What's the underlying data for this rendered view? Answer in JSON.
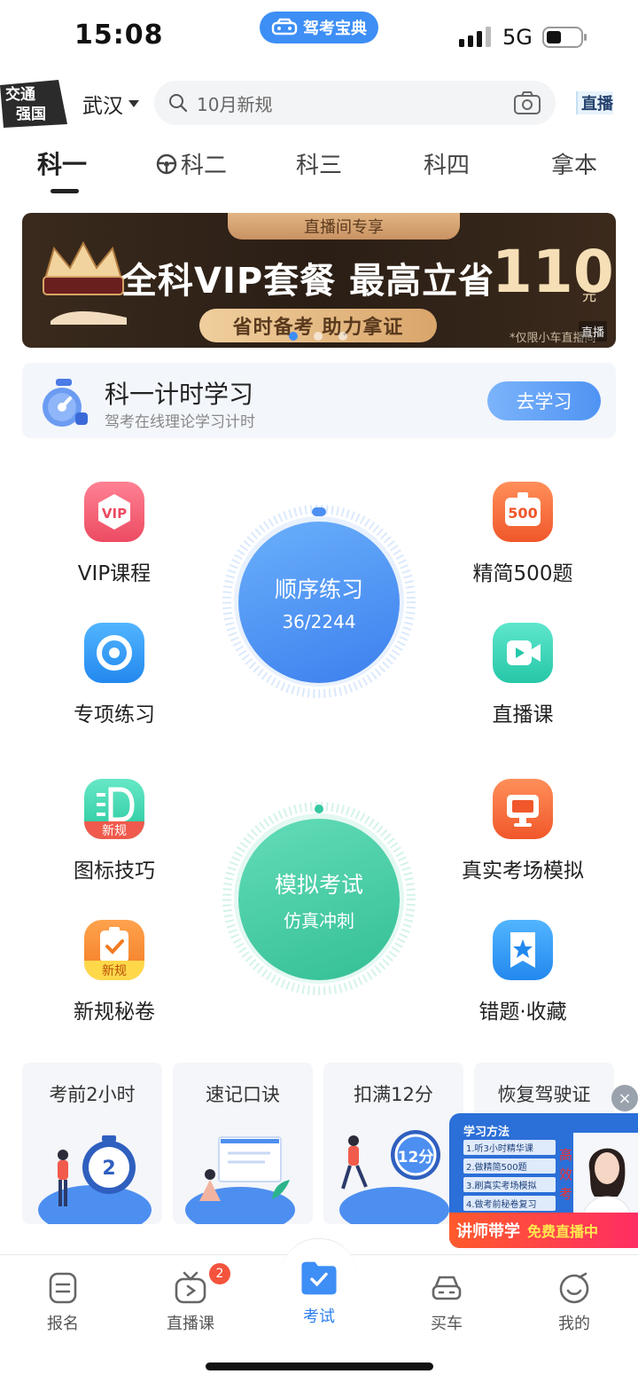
{
  "status_bar": {
    "time": "15:08",
    "network": "5G"
  },
  "app_pill": {
    "label": "驾考宝典"
  },
  "header": {
    "badge_text": "交通强国",
    "city": "武汉",
    "search_placeholder": "10月新规",
    "live_label": "直播"
  },
  "tabs": [
    {
      "label": "科一",
      "active": true
    },
    {
      "label": "科二",
      "active": false
    },
    {
      "label": "科三",
      "active": false
    },
    {
      "label": "科四",
      "active": false
    },
    {
      "label": "拿本",
      "active": false
    }
  ],
  "banner": {
    "tag": "直播间专享",
    "title": "全科VIP套餐 最高立省",
    "amount": "110",
    "unit": "元",
    "subtitle": "省时备考 助力拿证",
    "note": "*仅限小车直播间",
    "live_label": "直播",
    "slide_count": 3,
    "active_slide": 1
  },
  "timer_card": {
    "title": "科一计时学习",
    "subtitle": "驾考在线理论学习计时",
    "button": "去学习"
  },
  "grid_items": {
    "vip": {
      "label": "VIP课程",
      "icon_text": "VIP",
      "color": "#ee5a6e"
    },
    "jingjian": {
      "label": "精简500题",
      "icon_text": "500",
      "color": "#f2673a"
    },
    "zhuanxiang": {
      "label": "专项练习",
      "color": "#2f9bf0"
    },
    "zhibo": {
      "label": "直播课",
      "color": "#2fcfb4"
    },
    "tubiao": {
      "label": "图标技巧",
      "icon_text": "新规",
      "color": "#2fcfa8"
    },
    "zhenshi": {
      "label": "真实考场模拟",
      "color": "#f2673a"
    },
    "xingui": {
      "label": "新规秘卷",
      "icon_text": "新规",
      "color": "#f28a2a"
    },
    "cuoti": {
      "label": "错题·收藏",
      "color": "#2f9bf0"
    }
  },
  "practice_circle": {
    "title": "顺序练习",
    "progress_text": "36/2244",
    "done": 36,
    "total": 2244
  },
  "exam_circle": {
    "title": "模拟考试",
    "subtitle": "仿真冲刺"
  },
  "shortcut_cards": [
    {
      "title": "考前2小时",
      "art_text": "2"
    },
    {
      "title": "速记口诀"
    },
    {
      "title": "扣满12分",
      "art_text": "12分"
    },
    {
      "title": "恢复驾驶证"
    }
  ],
  "float_ad": {
    "close": "×",
    "heading": "学习方法",
    "steps": [
      "1.听3小时精华课",
      "2.做精简500题",
      "3.刷真实考场模拟",
      "4.做考前秘卷复习"
    ],
    "side_text": "高效考",
    "cta_left": "讲师带学",
    "cta_right": "免费直播中"
  },
  "bottom_nav": [
    {
      "label": "报名",
      "icon": "form-icon",
      "active": false
    },
    {
      "label": "直播课",
      "icon": "tv-icon",
      "active": false,
      "badge": "2"
    },
    {
      "label": "考试",
      "icon": "exam-folder-icon",
      "active": true
    },
    {
      "label": "买车",
      "icon": "car-icon",
      "active": false
    },
    {
      "label": "我的",
      "icon": "smile-icon",
      "active": false
    }
  ],
  "colors": {
    "accent": "#3d8ef5",
    "badge_red": "#f4533d"
  }
}
